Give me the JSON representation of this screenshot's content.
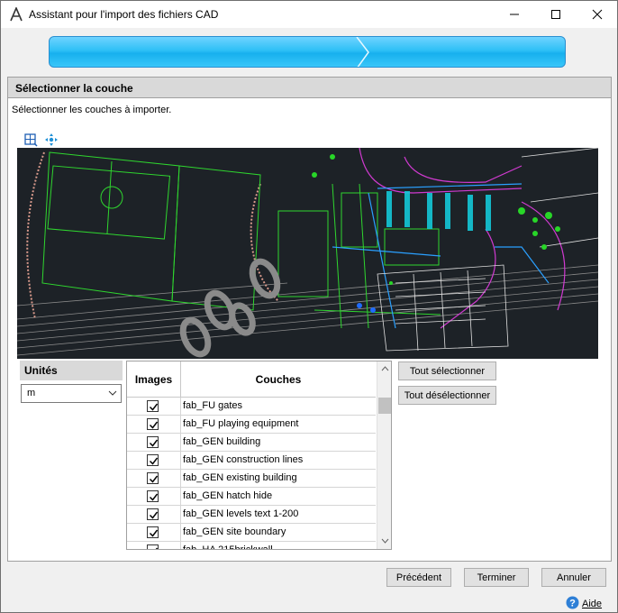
{
  "window": {
    "title": "Assistant pour l'import des fichiers CAD"
  },
  "section": {
    "title": "Sélectionner la couche",
    "instructions": "Sélectionner les couches à importer."
  },
  "toolbar": {
    "icons": [
      "zoom-extents-icon",
      "pan-icon"
    ]
  },
  "units": {
    "label": "Unités",
    "value": "m"
  },
  "layers": {
    "header_images": "Images",
    "header_layers": "Couches",
    "rows": [
      {
        "name": "fab_FU gates",
        "checked": true
      },
      {
        "name": "fab_FU playing equipment",
        "checked": true
      },
      {
        "name": "fab_GEN building",
        "checked": true
      },
      {
        "name": "fab_GEN construction lines",
        "checked": true
      },
      {
        "name": "fab_GEN existing building",
        "checked": true
      },
      {
        "name": "fab_GEN hatch hide",
        "checked": true
      },
      {
        "name": "fab_GEN levels text 1-200",
        "checked": true
      },
      {
        "name": "fab_GEN site boundary",
        "checked": true
      },
      {
        "name": "fab_HA 215brickwall",
        "checked": true
      }
    ]
  },
  "buttons": {
    "select_all": "Tout sélectionner",
    "deselect_all": "Tout désélectionner",
    "previous": "Précédent",
    "finish": "Terminer",
    "cancel": "Annuler",
    "help": "Aide"
  },
  "colors": {
    "progress": "#2ec0f6",
    "cad_background": "#1d2227"
  }
}
